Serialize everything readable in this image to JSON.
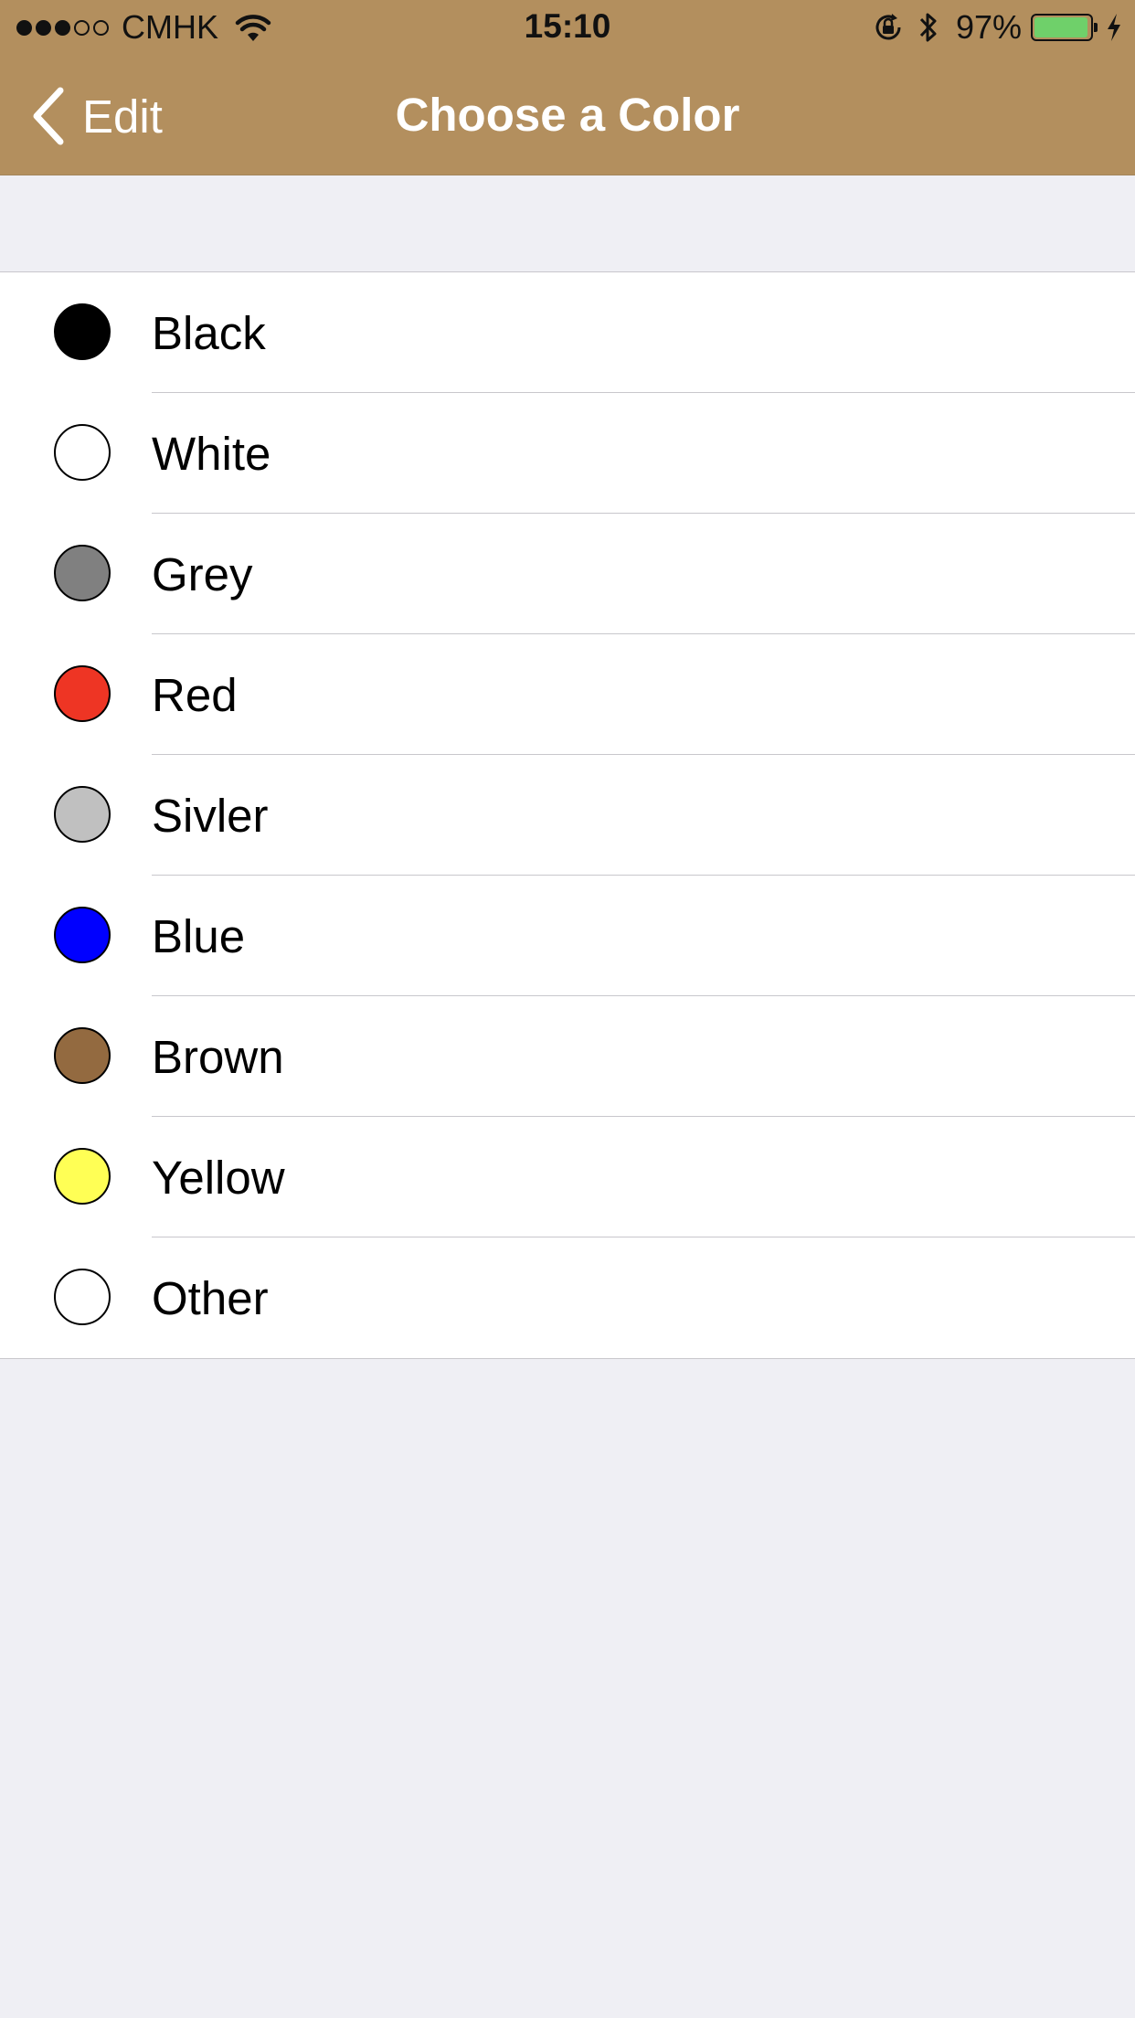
{
  "status_bar": {
    "carrier": "CMHK",
    "time": "15:10",
    "battery_percent": "97%",
    "signal_bars_filled": 3,
    "signal_bars_total": 5,
    "battery_level": 0.97,
    "battery_color": "#6fd06a"
  },
  "nav": {
    "back_label": "Edit",
    "title": "Choose a Color",
    "background": "#b38f5e"
  },
  "colors": [
    {
      "label": "Black",
      "swatch": "#000000"
    },
    {
      "label": "White",
      "swatch": "#ffffff"
    },
    {
      "label": "Grey",
      "swatch": "#808080"
    },
    {
      "label": "Red",
      "swatch": "#ee3524"
    },
    {
      "label": "Sivler",
      "swatch": "#c0c0c0"
    },
    {
      "label": "Blue",
      "swatch": "#0000ff"
    },
    {
      "label": "Brown",
      "swatch": "#936a40"
    },
    {
      "label": "Yellow",
      "swatch": "#ffff55"
    },
    {
      "label": "Other",
      "swatch": "#ffffff"
    }
  ]
}
